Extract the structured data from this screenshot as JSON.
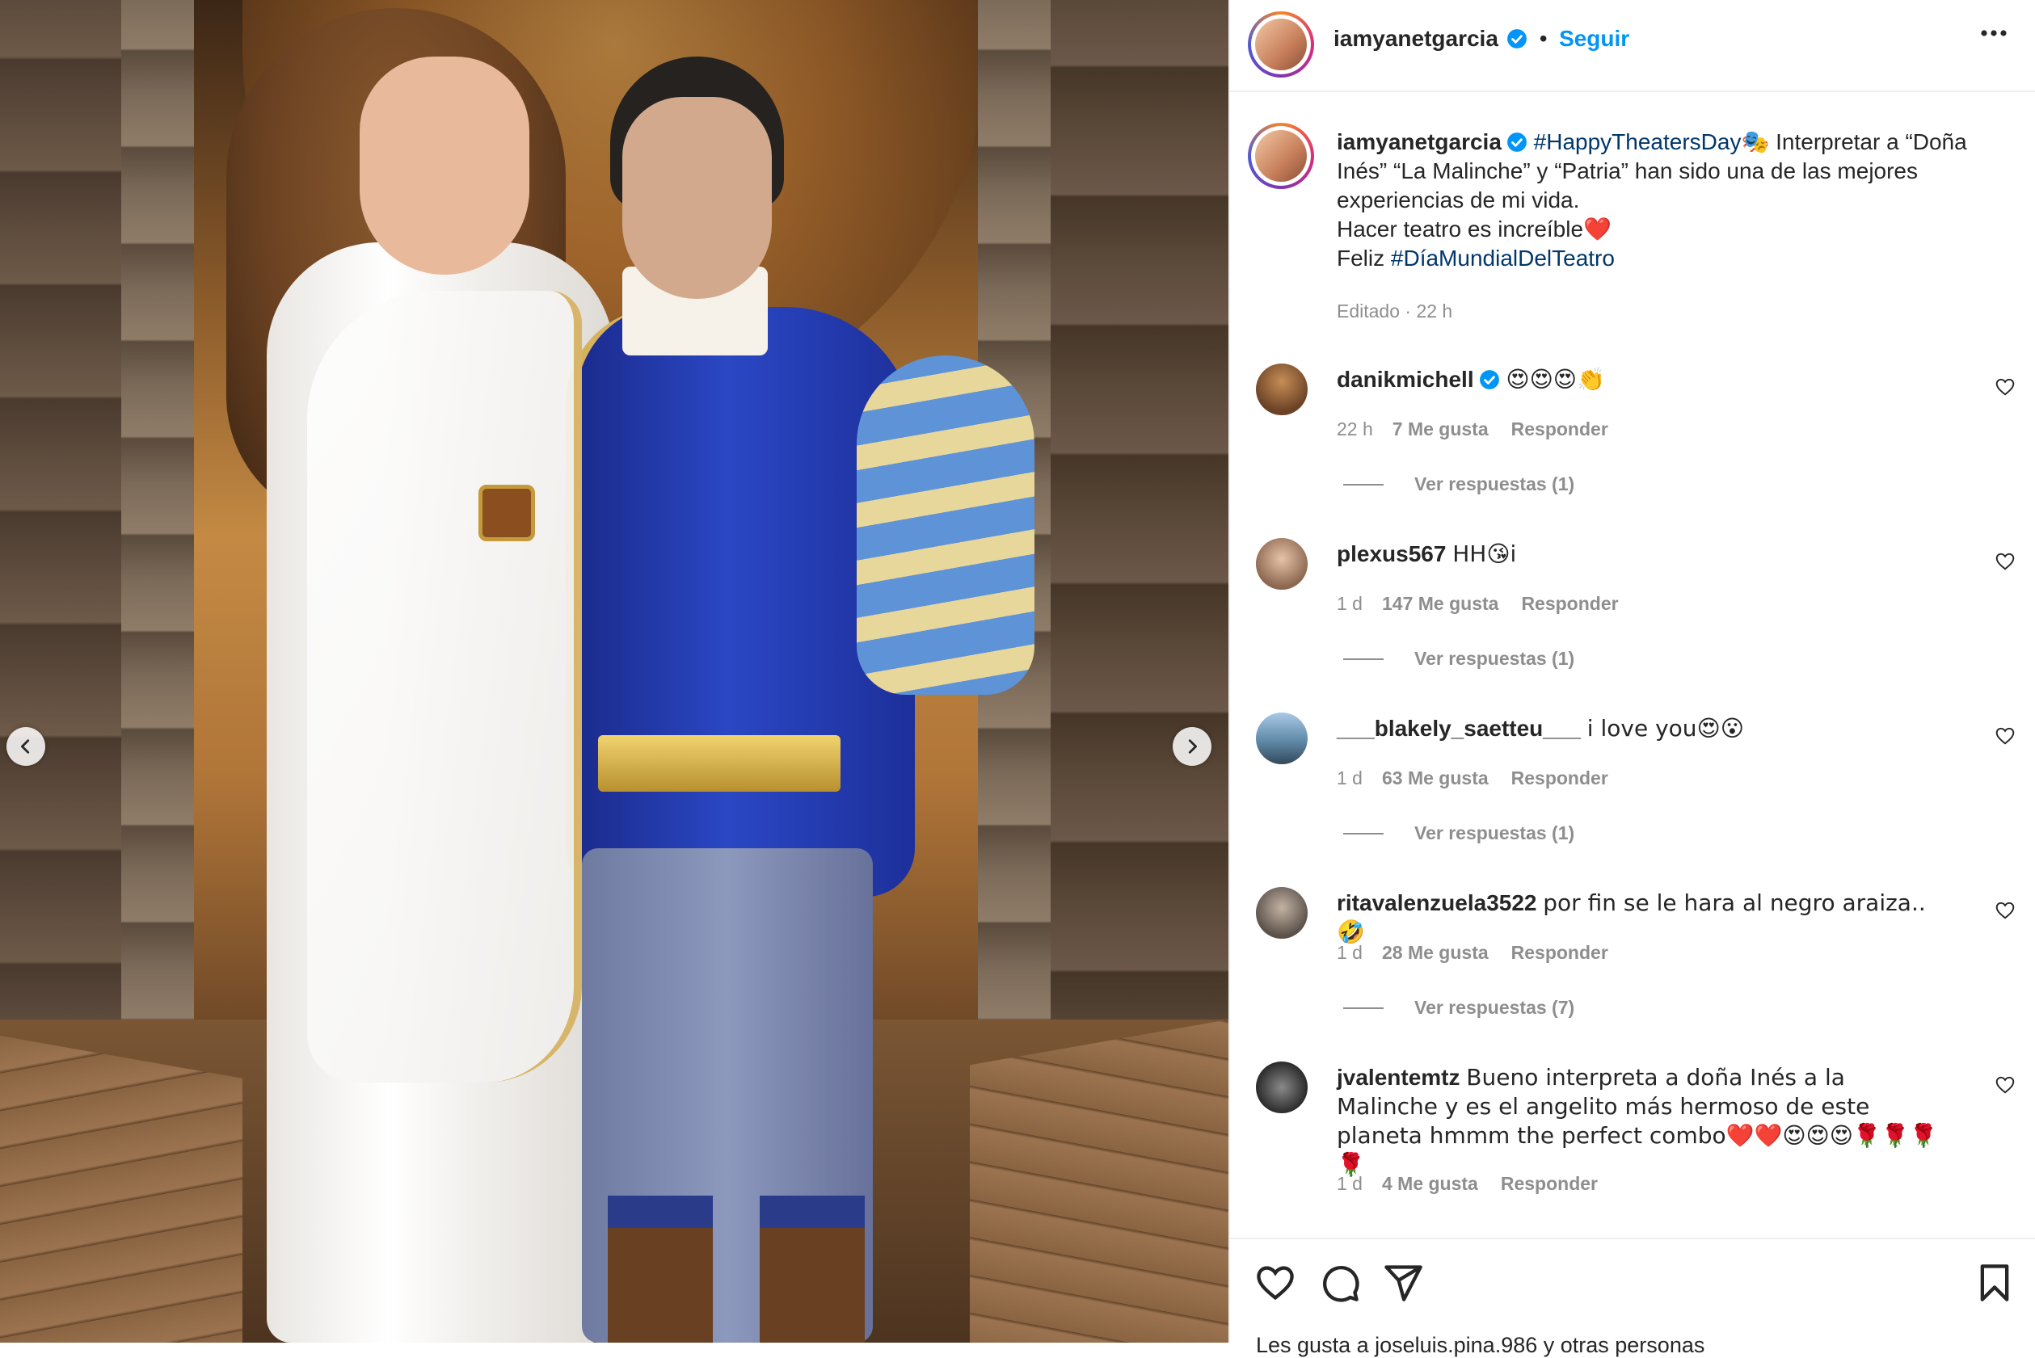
{
  "post": {
    "username": "iamyanetgarcia",
    "follow_label": "Seguir",
    "caption": {
      "username": "iamyanetgarcia",
      "hashtag1": "#HappyTheatersDay",
      "emoji1": "🎭",
      "text1": " Interpretar a “Doña Inés” “La Malinche” y “Patria” han sido una de las mejores experiencias de mi vida.",
      "line2": "Hacer teatro es increíble❤️",
      "line3_prefix": "Feliz ",
      "hashtag2": "#DíaMundialDelTeatro"
    },
    "edited_time": "Editado · 22 h"
  },
  "comments": [
    {
      "username": "danikmichell",
      "verified": true,
      "text": "😍😍😍👏",
      "time": "22 h",
      "likes": "7 Me gusta",
      "reply": "Responder",
      "replies": "Ver respuestas (1)"
    },
    {
      "username": "plexus567",
      "verified": false,
      "text": "HH😘i",
      "time": "1 d",
      "likes": "147 Me gusta",
      "reply": "Responder",
      "replies": "Ver respuestas (1)"
    },
    {
      "username": "___blakely_saetteu___",
      "verified": false,
      "text": "i love you😍😮",
      "time": "1 d",
      "likes": "63 Me gusta",
      "reply": "Responder",
      "replies": "Ver respuestas (1)"
    },
    {
      "username": "ritavalenzuela3522",
      "verified": false,
      "text": "por fin se le hara al negro araiza..🤣",
      "time": "1 d",
      "likes": "28 Me gusta",
      "reply": "Responder",
      "replies": "Ver respuestas (7)"
    },
    {
      "username": "jvalentemtz",
      "verified": false,
      "text": "Bueno interpreta a doña Inés a la Malinche y es el angelito más hermoso de este planeta hmmm the perfect combo❤️❤️😍😍😍🌹🌹🌹🌹",
      "time": "1 d",
      "likes": "4 Me gusta",
      "reply": "Responder",
      "replies": ""
    }
  ],
  "actions": {
    "like_icon": "heart-icon",
    "comment_icon": "comment-icon",
    "share_icon": "send-icon",
    "save_icon": "bookmark-icon"
  },
  "likes_line": "Les gusta a joseluis.pina.986 y otras personas",
  "colors": {
    "accent": "#0095f6",
    "hashtag": "#00376b",
    "muted": "#8e8e8e",
    "verified": "#0095f6"
  }
}
